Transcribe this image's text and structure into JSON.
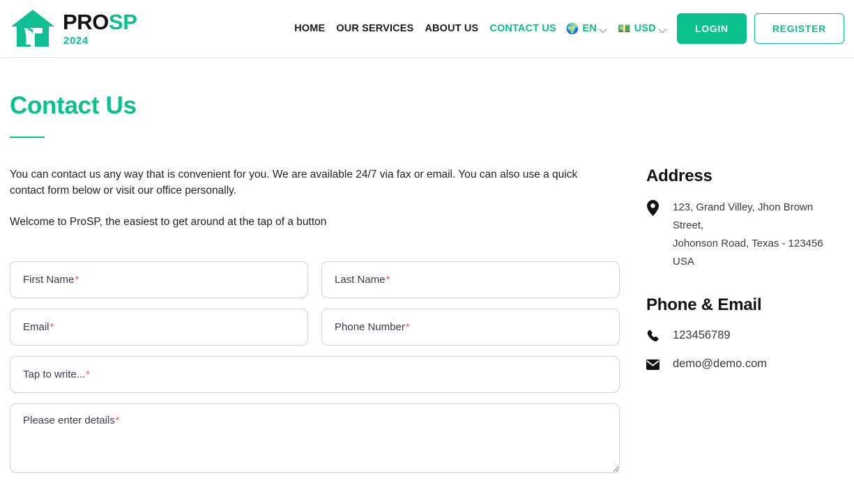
{
  "header": {
    "logo": {
      "icon": "house-with-tool-icon",
      "name_part1": "PRO",
      "name_part2": "SP",
      "year": "2024"
    },
    "nav_links": [
      {
        "label": "HOME",
        "active": false
      },
      {
        "label": "OUR SERVICES",
        "active": false
      },
      {
        "label": "ABOUT US",
        "active": false
      },
      {
        "label": "CONTACT US",
        "active": true
      }
    ],
    "language_selector": {
      "icon": "globe-icon",
      "value": "EN"
    },
    "currency_selector": {
      "icon": "banknote-icon",
      "value": "USD"
    },
    "login_label": "LOGIN",
    "register_label": "REGISTER"
  },
  "main": {
    "title": "Contact Us",
    "paragraph1": "You can contact us any way that is convenient for you. We are available 24/7 via fax or email. You can also use a quick contact form below or visit our office personally.",
    "paragraph2": "Welcome to ProSP, the easiest to get around at the tap of a button",
    "form": {
      "first_name": {
        "placeholder": "First Name",
        "required_mark": "*",
        "value": ""
      },
      "last_name": {
        "placeholder": "Last Name",
        "required_mark": "*",
        "value": ""
      },
      "email": {
        "placeholder": "Email",
        "required_mark": "*",
        "value": ""
      },
      "phone": {
        "placeholder": "Phone Number",
        "required_mark": "*",
        "value": ""
      },
      "subject": {
        "placeholder": "Tap to write...",
        "required_mark": "*",
        "value": ""
      },
      "details": {
        "placeholder": "Please enter details",
        "required_mark": "*",
        "value": ""
      }
    }
  },
  "sidebar": {
    "address": {
      "title": "Address",
      "icon": "map-pin-icon",
      "line1": "123, Grand Villey, Jhon Brown Street,",
      "line2": "Johonson Road, Texas - 123456",
      "line3": "USA"
    },
    "contact": {
      "title": "Phone & Email",
      "phone_icon": "phone-icon",
      "phone": "123456789",
      "email_icon": "envelope-icon",
      "email": "demo@demo.com"
    }
  },
  "colors": {
    "accent": "#0ac18e",
    "text": "#1d1d1d",
    "required": "#e8635f",
    "border": "#d2d2d2"
  }
}
